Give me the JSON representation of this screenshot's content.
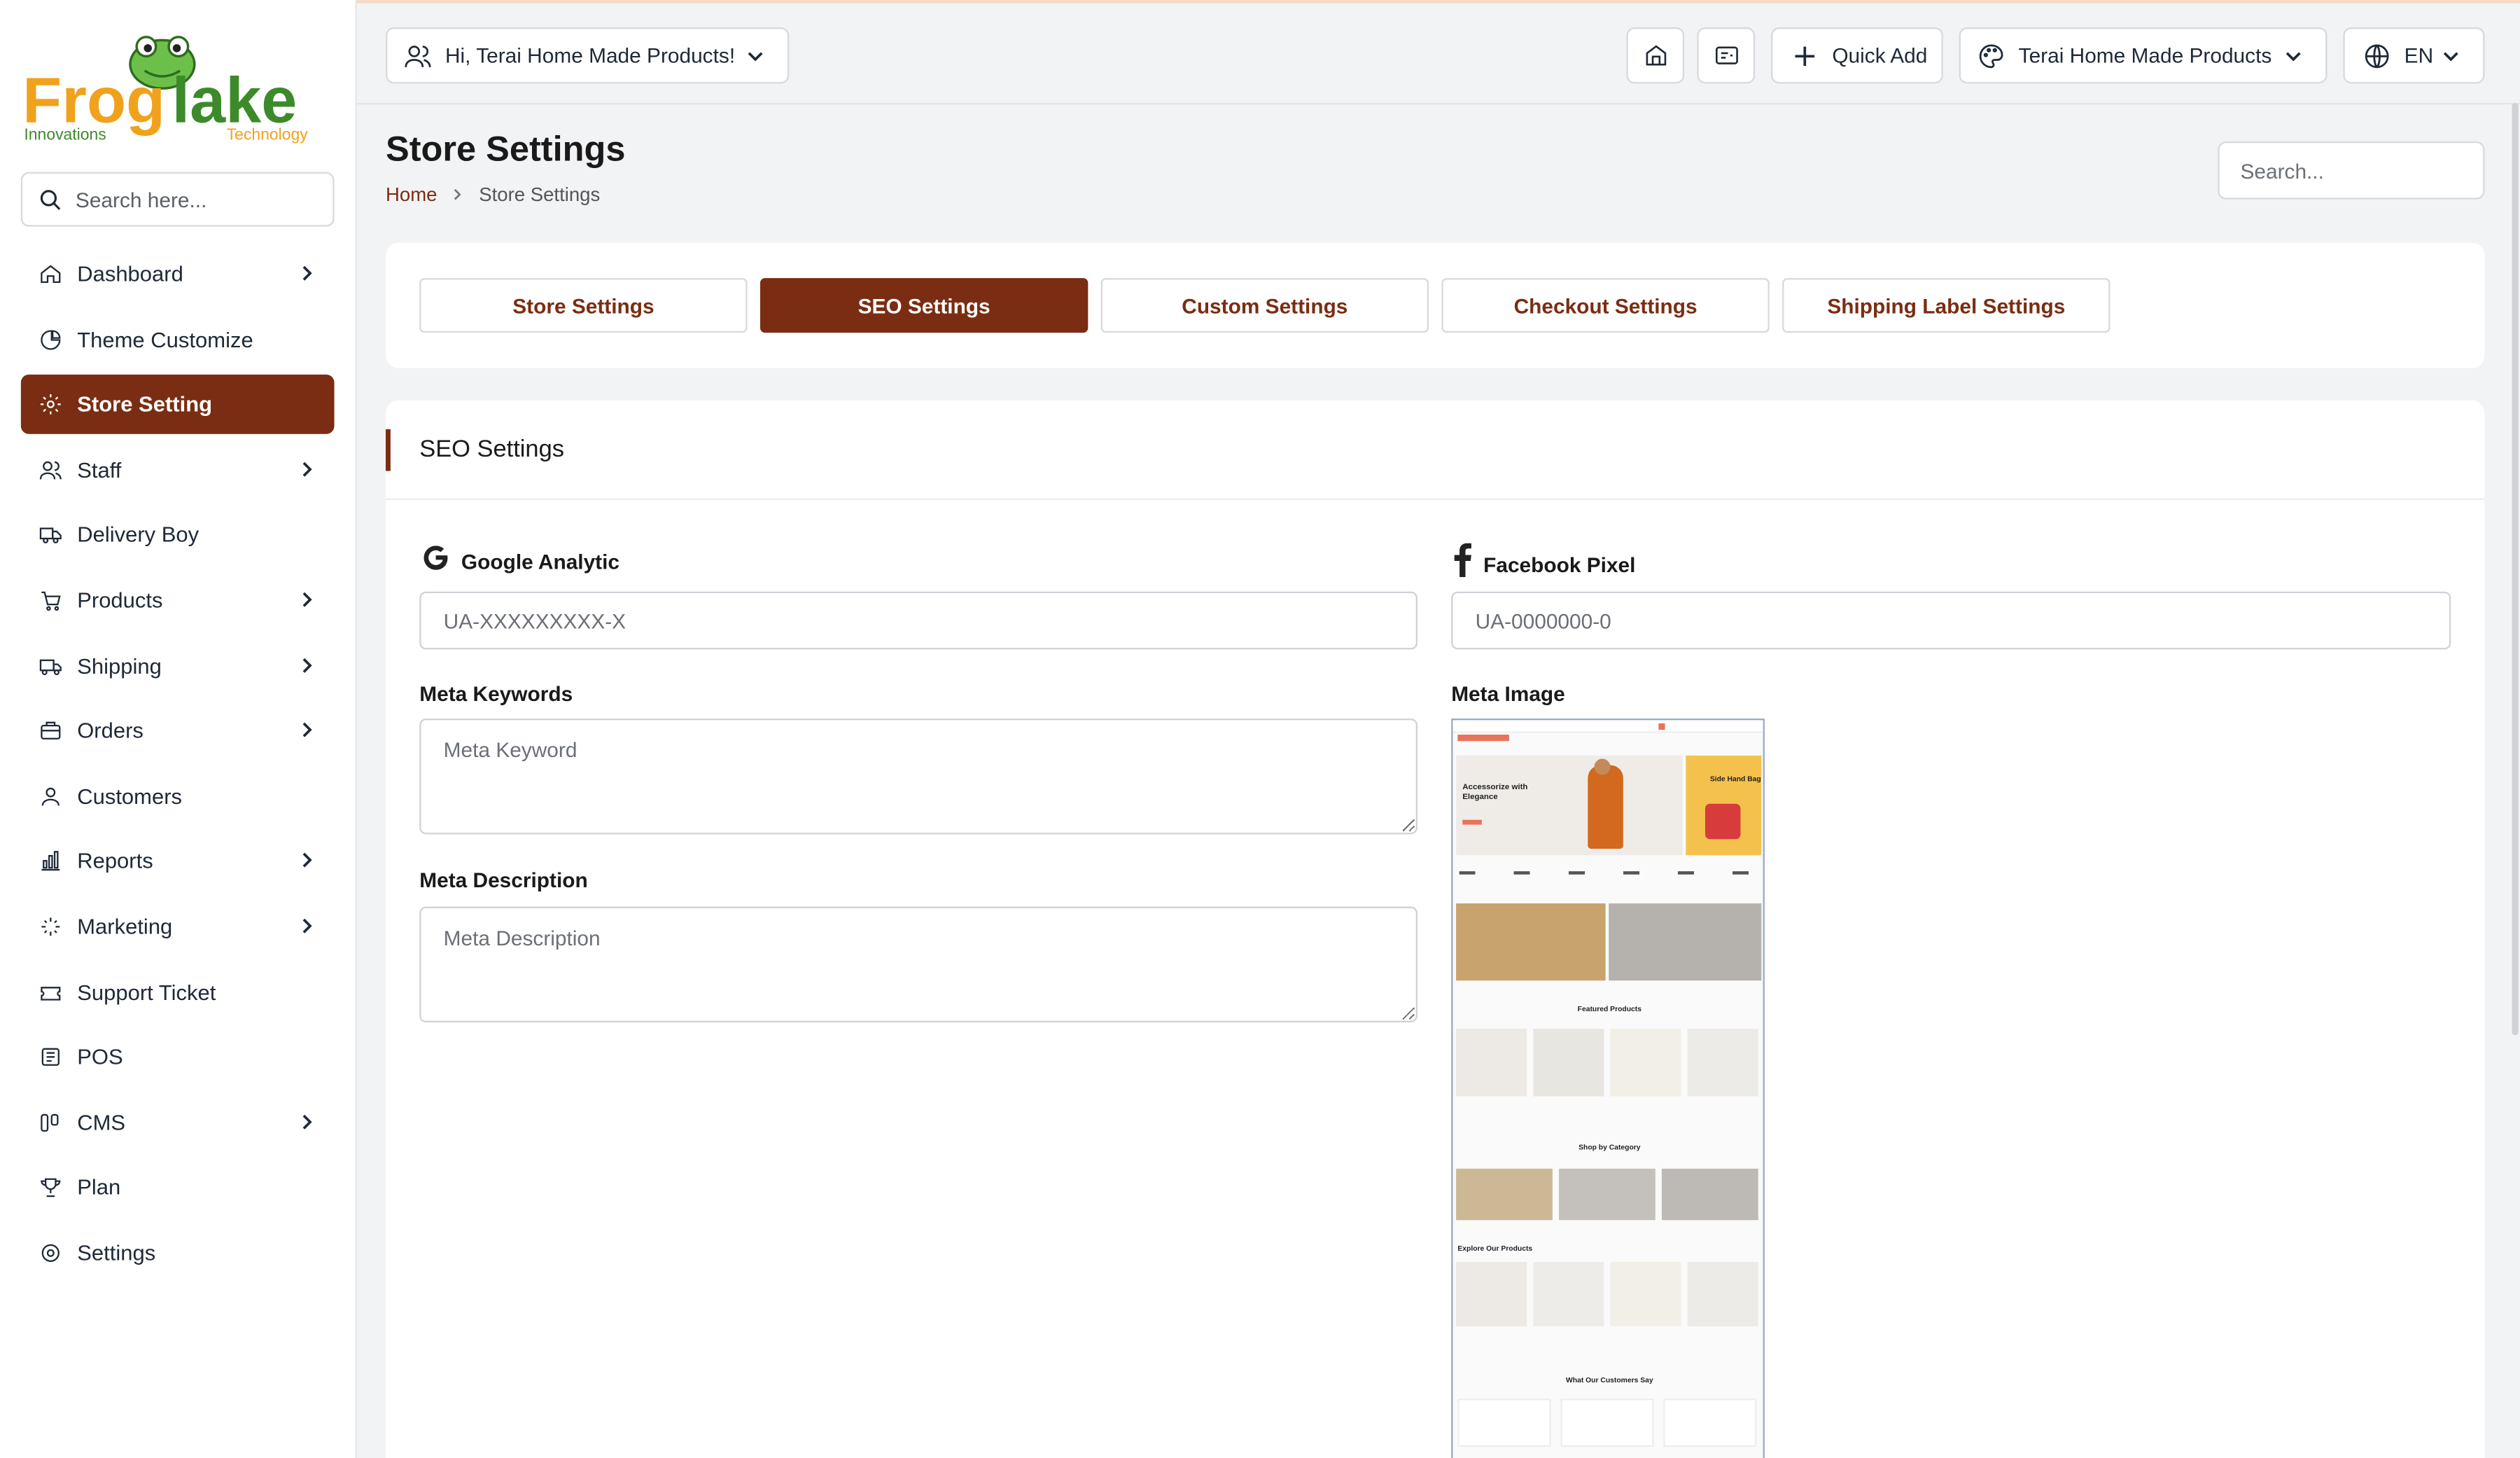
{
  "brand": {
    "logo_main": "Froglake",
    "logo_left_sub": "Innovations",
    "logo_right_sub": "Technology",
    "colors": {
      "accent": "#7a2d12",
      "logo_orange": "#f0a21c",
      "logo_green": "#3d8a2b"
    }
  },
  "sidebar": {
    "search_placeholder": "Search here...",
    "items": [
      {
        "label": "Dashboard",
        "icon": "home-icon",
        "has_children": true,
        "active": false
      },
      {
        "label": "Theme Customize",
        "icon": "theme-icon",
        "has_children": false,
        "active": false
      },
      {
        "label": "Store Setting",
        "icon": "gear-icon",
        "has_children": false,
        "active": true
      },
      {
        "label": "Staff",
        "icon": "users-icon",
        "has_children": true,
        "active": false
      },
      {
        "label": "Delivery Boy",
        "icon": "truck-icon",
        "has_children": false,
        "active": false
      },
      {
        "label": "Products",
        "icon": "cart-icon",
        "has_children": true,
        "active": false
      },
      {
        "label": "Shipping",
        "icon": "shipping-icon",
        "has_children": true,
        "active": false
      },
      {
        "label": "Orders",
        "icon": "orders-icon",
        "has_children": true,
        "active": false
      },
      {
        "label": "Customers",
        "icon": "user-icon",
        "has_children": false,
        "active": false
      },
      {
        "label": "Reports",
        "icon": "chart-icon",
        "has_children": true,
        "active": false
      },
      {
        "label": "Marketing",
        "icon": "sparkle-icon",
        "has_children": true,
        "active": false
      },
      {
        "label": "Support Ticket",
        "icon": "ticket-icon",
        "has_children": false,
        "active": false
      },
      {
        "label": "POS",
        "icon": "pos-icon",
        "has_children": false,
        "active": false
      },
      {
        "label": "CMS",
        "icon": "cms-icon",
        "has_children": true,
        "active": false
      },
      {
        "label": "Plan",
        "icon": "trophy-icon",
        "has_children": false,
        "active": false
      },
      {
        "label": "Settings",
        "icon": "settings-icon",
        "has_children": false,
        "active": false
      }
    ]
  },
  "topbar": {
    "user_greeting": "Hi, Terai Home Made Products!",
    "quick_add_label": "Quick Add",
    "store_selector": "Terai Home Made Products",
    "language": "EN"
  },
  "page": {
    "title": "Store Settings",
    "breadcrumb_home": "Home",
    "breadcrumb_current": "Store Settings",
    "search_placeholder": "Search..."
  },
  "tabs": [
    {
      "label": "Store Settings",
      "active": false
    },
    {
      "label": "SEO Settings",
      "active": true
    },
    {
      "label": "Custom Settings",
      "active": false
    },
    {
      "label": "Checkout Settings",
      "active": false
    },
    {
      "label": "Shipping Label Settings",
      "active": false
    }
  ],
  "seo": {
    "card_title": "SEO Settings",
    "google_label": "Google Analytic",
    "google_placeholder": "UA-XXXXXXXXX-X",
    "facebook_label": "Facebook Pixel",
    "facebook_placeholder": "UA-0000000-0",
    "keywords_label": "Meta Keywords",
    "keywords_placeholder": "Meta Keyword",
    "description_label": "Meta Description",
    "description_placeholder": "Meta Description",
    "image_label": "Meta Image"
  },
  "meta_image_preview": {
    "hero_title": "Accessorize with Elegance",
    "hero_side": "Side Hand Bag",
    "featured": "Featured Products",
    "category": "Shop by Category",
    "explore": "Explore Our Products",
    "testimonials": "What Our Customers Say"
  }
}
